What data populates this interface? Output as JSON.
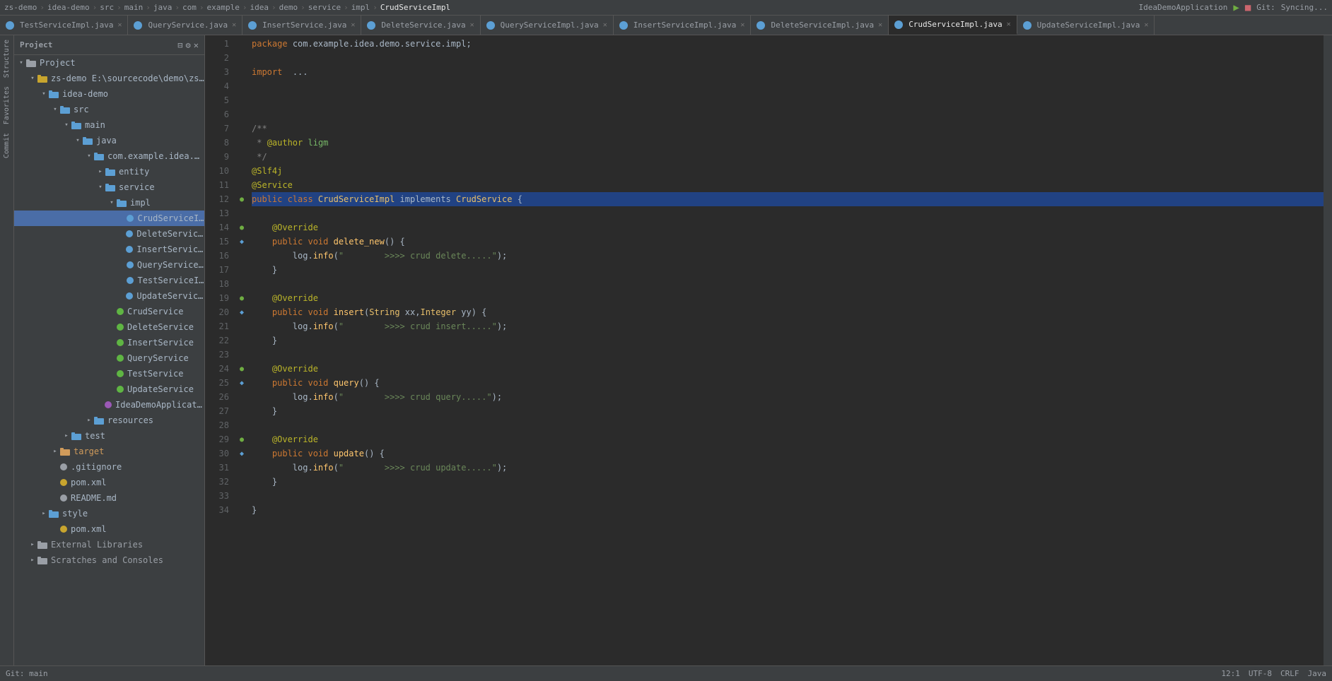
{
  "topbar": {
    "segments": [
      "zs-demo",
      "idea-demo",
      "src",
      "main",
      "java",
      "com",
      "example",
      "idea",
      "demo",
      "service",
      "impl",
      "CrudServiceImpl"
    ],
    "right": {
      "project_name": "IdeaDemoApplication",
      "git_label": "Git:",
      "syncing": "Syncing..."
    }
  },
  "tabs": [
    {
      "label": "TestServiceImpl.java",
      "color": "blue",
      "active": false
    },
    {
      "label": "QueryService.java",
      "color": "blue",
      "active": false
    },
    {
      "label": "InsertService.java",
      "color": "blue",
      "active": false
    },
    {
      "label": "DeleteService.java",
      "color": "blue",
      "active": false
    },
    {
      "label": "QueryServiceImpl.java",
      "color": "blue",
      "active": false
    },
    {
      "label": "InsertServiceImpl.java",
      "color": "blue",
      "active": false
    },
    {
      "label": "DeleteServiceImpl.java",
      "color": "blue",
      "active": false
    },
    {
      "label": "CrudServiceImpl.java",
      "color": "blue",
      "active": true
    },
    {
      "label": "UpdateServiceImpl.java",
      "color": "blue",
      "active": false
    }
  ],
  "sidebar": {
    "title": "Project",
    "tree": [
      {
        "indent": 0,
        "type": "folder",
        "open": true,
        "label": "Project",
        "icon": "project"
      },
      {
        "indent": 1,
        "type": "folder",
        "open": true,
        "label": "zs-demo  E:\\sourcecode\\demo\\zs-demo",
        "icon": "folder-yellow"
      },
      {
        "indent": 2,
        "type": "folder",
        "open": true,
        "label": "idea-demo",
        "icon": "folder-blue"
      },
      {
        "indent": 3,
        "type": "folder",
        "open": true,
        "label": "src",
        "icon": "folder-blue"
      },
      {
        "indent": 4,
        "type": "folder",
        "open": true,
        "label": "main",
        "icon": "folder-blue"
      },
      {
        "indent": 5,
        "type": "folder",
        "open": true,
        "label": "java",
        "icon": "folder-blue"
      },
      {
        "indent": 6,
        "type": "folder",
        "open": true,
        "label": "com.example.idea.demo",
        "icon": "folder-blue"
      },
      {
        "indent": 7,
        "type": "folder",
        "open": false,
        "label": "entity",
        "icon": "folder-blue"
      },
      {
        "indent": 7,
        "type": "folder",
        "open": true,
        "label": "service",
        "icon": "folder-blue"
      },
      {
        "indent": 8,
        "type": "folder",
        "open": true,
        "label": "impl",
        "icon": "folder-blue"
      },
      {
        "indent": 9,
        "type": "file",
        "label": "CrudServiceImpl",
        "filecolor": "blue",
        "selected": true
      },
      {
        "indent": 9,
        "type": "file",
        "label": "DeleteServiceImpl",
        "filecolor": "blue"
      },
      {
        "indent": 9,
        "type": "file",
        "label": "InsertServiceImpl",
        "filecolor": "blue"
      },
      {
        "indent": 9,
        "type": "file",
        "label": "QueryServiceImpl",
        "filecolor": "blue"
      },
      {
        "indent": 9,
        "type": "file",
        "label": "TestServiceImpl",
        "filecolor": "blue"
      },
      {
        "indent": 9,
        "type": "file",
        "label": "UpdateServiceImpl",
        "filecolor": "blue"
      },
      {
        "indent": 8,
        "type": "interface",
        "label": "CrudService",
        "filecolor": "green"
      },
      {
        "indent": 8,
        "type": "interface",
        "label": "DeleteService",
        "filecolor": "green"
      },
      {
        "indent": 8,
        "type": "interface",
        "label": "InsertService",
        "filecolor": "green"
      },
      {
        "indent": 8,
        "type": "interface",
        "label": "QueryService",
        "filecolor": "green"
      },
      {
        "indent": 8,
        "type": "interface",
        "label": "TestService",
        "filecolor": "green"
      },
      {
        "indent": 8,
        "type": "interface",
        "label": "UpdateService",
        "filecolor": "green"
      },
      {
        "indent": 7,
        "type": "file",
        "label": "IdeaDemoApplication",
        "filecolor": "purple"
      },
      {
        "indent": 6,
        "type": "folder",
        "open": false,
        "label": "resources",
        "icon": "folder-blue"
      },
      {
        "indent": 4,
        "type": "folder",
        "open": false,
        "label": "test",
        "icon": "folder-blue"
      },
      {
        "indent": 3,
        "type": "folder",
        "open": false,
        "label": "target",
        "icon": "folder-orange"
      },
      {
        "indent": 3,
        "type": "file",
        "label": ".gitignore",
        "filecolor": "gray"
      },
      {
        "indent": 3,
        "type": "file",
        "label": "pom.xml",
        "filecolor": "yellow"
      },
      {
        "indent": 3,
        "type": "file",
        "label": "README.md",
        "filecolor": "gray"
      },
      {
        "indent": 2,
        "type": "folder",
        "open": false,
        "label": "style",
        "icon": "folder-blue"
      },
      {
        "indent": 3,
        "type": "file",
        "label": "pom.xml",
        "filecolor": "yellow"
      },
      {
        "indent": 1,
        "type": "folder",
        "open": false,
        "label": "External Libraries",
        "icon": "folder-gray"
      },
      {
        "indent": 1,
        "type": "folder",
        "open": false,
        "label": "Scratches and Consoles",
        "icon": "folder-gray"
      }
    ]
  },
  "code": {
    "lines": [
      {
        "num": 1,
        "content": "plain:package com.example.idea.demo.service.impl;"
      },
      {
        "num": 2,
        "content": ""
      },
      {
        "num": 3,
        "content": "import_kw:import ..."
      },
      {
        "num": 4,
        "content": ""
      },
      {
        "num": 5,
        "content": ""
      },
      {
        "num": 6,
        "content": ""
      },
      {
        "num": 7,
        "content": "cmt:/**"
      },
      {
        "num": 8,
        "content": "cmt: * @author ligm"
      },
      {
        "num": 9,
        "content": "cmt: */"
      },
      {
        "num": 10,
        "content": "ann:@Slf4j"
      },
      {
        "num": 11,
        "content": "ann:@Service"
      },
      {
        "num": 12,
        "content": "class_decl:public class CrudServiceImpl implements CrudService {"
      },
      {
        "num": 13,
        "content": ""
      },
      {
        "num": 14,
        "content": "override:    @Override"
      },
      {
        "num": 15,
        "content": "method:    public void delete_new() {"
      },
      {
        "num": 16,
        "content": "log:        log.info(\">>>> crud delete.....\");"
      },
      {
        "num": 17,
        "content": "brace:    }"
      },
      {
        "num": 18,
        "content": ""
      },
      {
        "num": 19,
        "content": "override:    @Override"
      },
      {
        "num": 20,
        "content": "method:    public void insert(String xx,Integer yy) {"
      },
      {
        "num": 21,
        "content": "log:        log.info(\">>>> crud insert.....\");"
      },
      {
        "num": 22,
        "content": "brace:    }"
      },
      {
        "num": 23,
        "content": ""
      },
      {
        "num": 24,
        "content": "override:    @Override"
      },
      {
        "num": 25,
        "content": "method:    public void query() {"
      },
      {
        "num": 26,
        "content": "log:        log.info(\">>>> crud query.....\");"
      },
      {
        "num": 27,
        "content": "brace:    }"
      },
      {
        "num": 28,
        "content": ""
      },
      {
        "num": 29,
        "content": "override:    @Override"
      },
      {
        "num": 30,
        "content": "method:    public void update() {"
      },
      {
        "num": 31,
        "content": "log:        log.info(\">>>> crud update.....\");"
      },
      {
        "num": 32,
        "content": "brace:    }"
      },
      {
        "num": 33,
        "content": ""
      },
      {
        "num": 34,
        "content": "closebrace:}"
      }
    ]
  },
  "statusbar": {
    "git": "Git: main",
    "line_col": "12:1",
    "encoding": "UTF-8",
    "line_sep": "CRLF",
    "lang": "Java"
  },
  "left_strip": {
    "labels": [
      "Structure",
      "Favorites",
      "Commit"
    ]
  }
}
